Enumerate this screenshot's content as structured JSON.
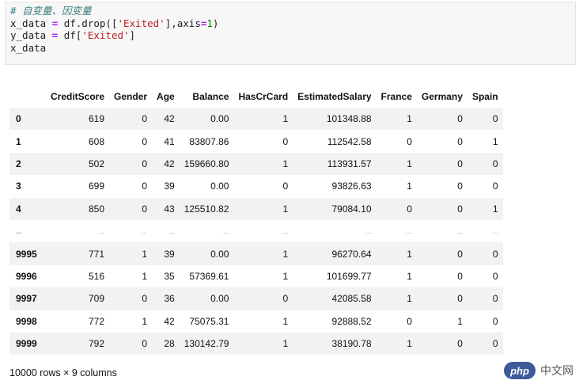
{
  "code": {
    "comment": "# 自变量、因变量",
    "line2_var": "x_data",
    "line2_eq": " = ",
    "line2_call": "df.drop([",
    "line2_str": "'Exited'",
    "line2_rest": "],axis",
    "line2_eq2": "=",
    "line2_num": "1",
    "line2_close": ")",
    "line3_var": "y_data",
    "line3_eq": " = ",
    "line3_call": "df[",
    "line3_str": "'Exited'",
    "line3_close": "]",
    "line4": "x_data"
  },
  "table": {
    "columns": [
      "CreditScore",
      "Gender",
      "Age",
      "Balance",
      "HasCrCard",
      "EstimatedSalary",
      "France",
      "Germany",
      "Spain"
    ],
    "rows": [
      {
        "index": "0",
        "cells": [
          "619",
          "0",
          "42",
          "0.00",
          "1",
          "101348.88",
          "1",
          "0",
          "0"
        ]
      },
      {
        "index": "1",
        "cells": [
          "608",
          "0",
          "41",
          "83807.86",
          "0",
          "112542.58",
          "0",
          "0",
          "1"
        ]
      },
      {
        "index": "2",
        "cells": [
          "502",
          "0",
          "42",
          "159660.80",
          "1",
          "113931.57",
          "1",
          "0",
          "0"
        ]
      },
      {
        "index": "3",
        "cells": [
          "699",
          "0",
          "39",
          "0.00",
          "0",
          "93826.63",
          "1",
          "0",
          "0"
        ]
      },
      {
        "index": "4",
        "cells": [
          "850",
          "0",
          "43",
          "125510.82",
          "1",
          "79084.10",
          "0",
          "0",
          "1"
        ]
      },
      {
        "index": "...",
        "cells": [
          "...",
          "...",
          "...",
          "...",
          "...",
          "...",
          "...",
          "...",
          "..."
        ],
        "ellipsis": true
      },
      {
        "index": "9995",
        "cells": [
          "771",
          "1",
          "39",
          "0.00",
          "1",
          "96270.64",
          "1",
          "0",
          "0"
        ]
      },
      {
        "index": "9996",
        "cells": [
          "516",
          "1",
          "35",
          "57369.61",
          "1",
          "101699.77",
          "1",
          "0",
          "0"
        ]
      },
      {
        "index": "9997",
        "cells": [
          "709",
          "0",
          "36",
          "0.00",
          "0",
          "42085.58",
          "1",
          "0",
          "0"
        ]
      },
      {
        "index": "9998",
        "cells": [
          "772",
          "1",
          "42",
          "75075.31",
          "1",
          "92888.52",
          "0",
          "1",
          "0"
        ]
      },
      {
        "index": "9999",
        "cells": [
          "792",
          "0",
          "28",
          "130142.79",
          "1",
          "38190.78",
          "1",
          "0",
          "0"
        ]
      }
    ]
  },
  "shape_caption": "10000 rows × 9 columns",
  "watermark": {
    "badge": "php",
    "text": "中文网"
  }
}
